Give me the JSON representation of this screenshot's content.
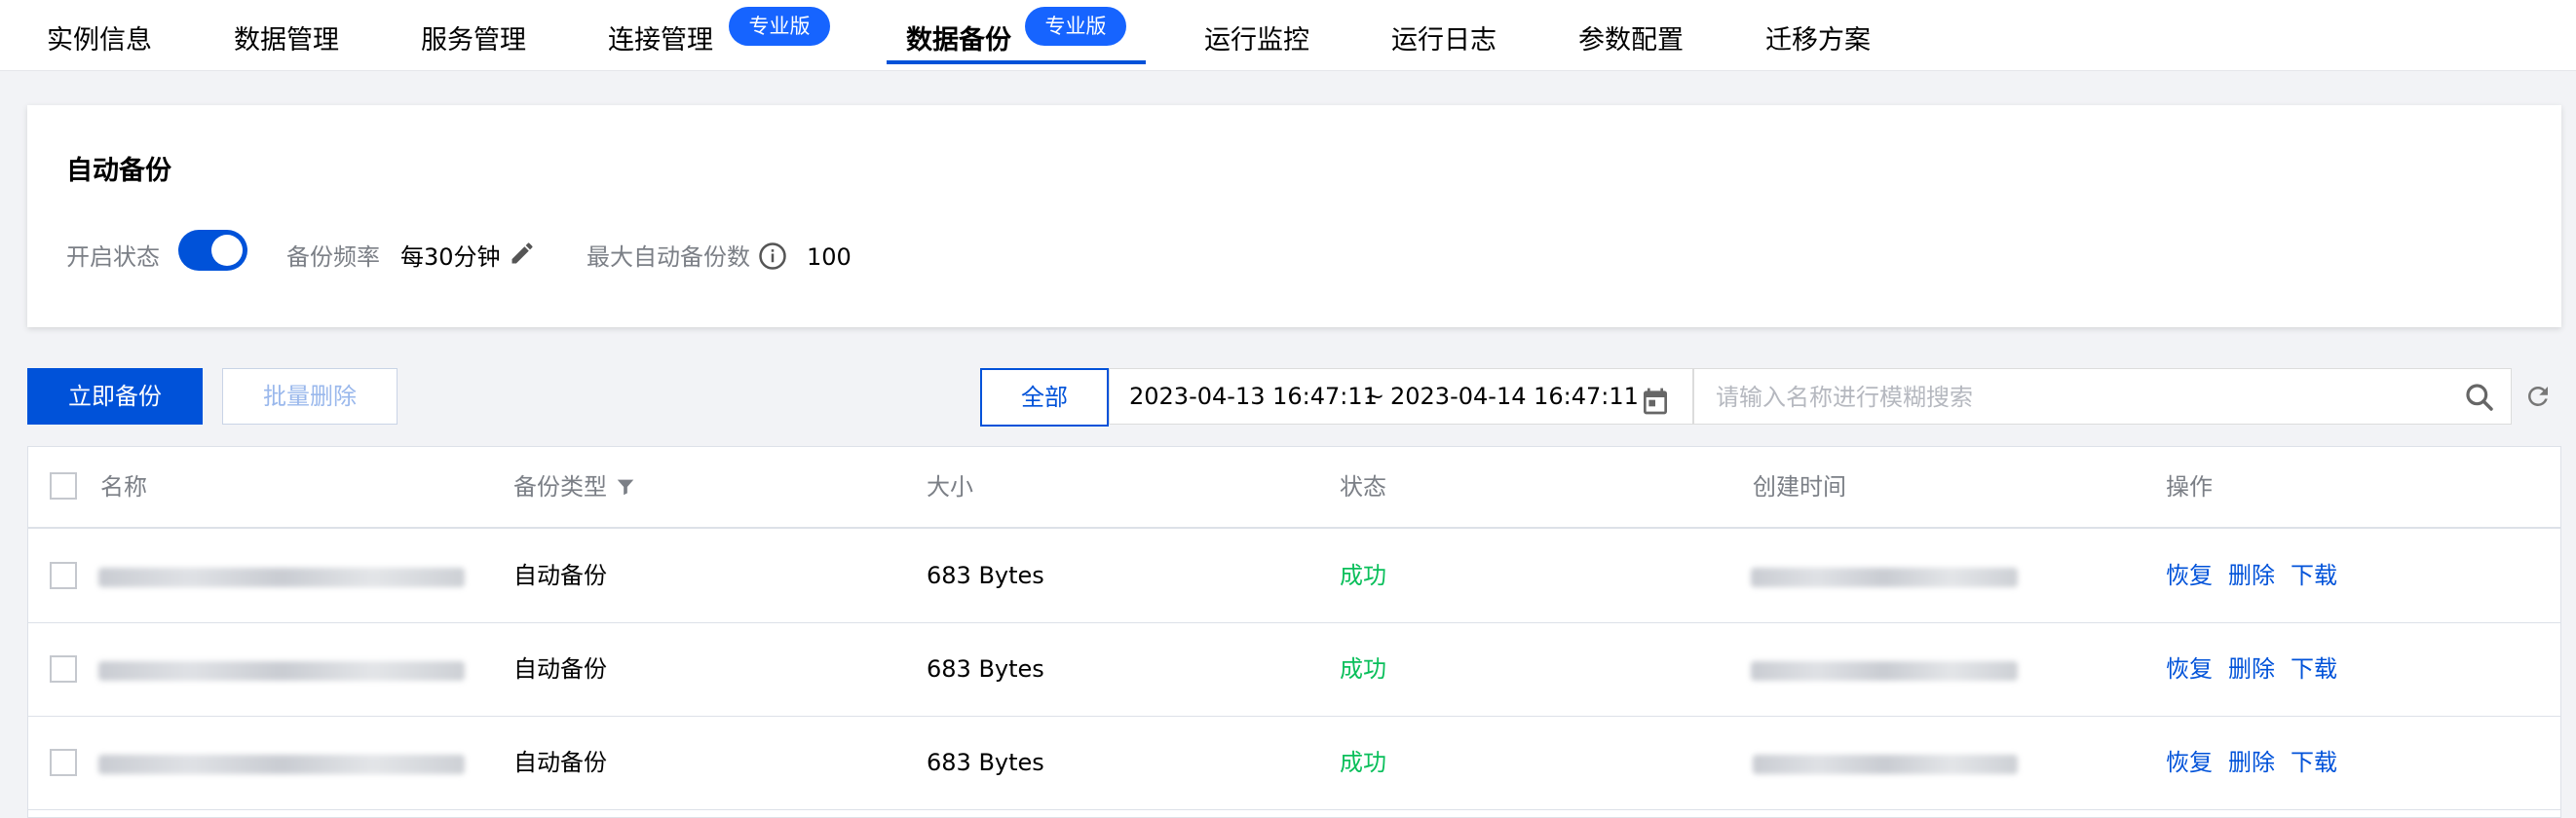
{
  "tabs": [
    {
      "label": "实例信息"
    },
    {
      "label": "数据管理"
    },
    {
      "label": "服务管理"
    },
    {
      "label": "连接管理",
      "badge": "专业版"
    },
    {
      "label": "数据备份",
      "badge": "专业版",
      "active": true
    },
    {
      "label": "运行监控"
    },
    {
      "label": "运行日志"
    },
    {
      "label": "参数配置"
    },
    {
      "label": "迁移方案"
    }
  ],
  "auto_backup": {
    "title": "自动备份",
    "status_label": "开启状态",
    "enabled": true,
    "frequency_label": "备份频率",
    "frequency_value": "每30分钟",
    "max_label": "最大自动备份数",
    "max_value": "100"
  },
  "toolbar": {
    "backup_now": "立即备份",
    "batch_delete": "批量删除",
    "all": "全部",
    "date_start": "2023-04-13 16:47:11",
    "date_sep": "~",
    "date_end": "2023-04-14 16:47:11",
    "search_placeholder": "请输入名称进行模糊搜索"
  },
  "table": {
    "columns": [
      "名称",
      "备份类型",
      "大小",
      "状态",
      "创建时间",
      "操作"
    ],
    "rows": [
      {
        "type": "自动备份",
        "size": "683 Bytes",
        "status": "成功",
        "actions": [
          "恢复",
          "删除",
          "下载"
        ]
      },
      {
        "type": "自动备份",
        "size": "683 Bytes",
        "status": "成功",
        "actions": [
          "恢复",
          "删除",
          "下载"
        ]
      },
      {
        "type": "自动备份",
        "size": "683 Bytes",
        "status": "成功",
        "actions": [
          "恢复",
          "删除",
          "下载"
        ]
      }
    ]
  },
  "colors": {
    "primary": "#0052d9",
    "badge": "#1664ff",
    "success": "#0abf5b"
  },
  "icons": [
    "edit-icon",
    "info-icon",
    "calendar-icon",
    "search-icon",
    "refresh-icon",
    "filter-icon"
  ]
}
